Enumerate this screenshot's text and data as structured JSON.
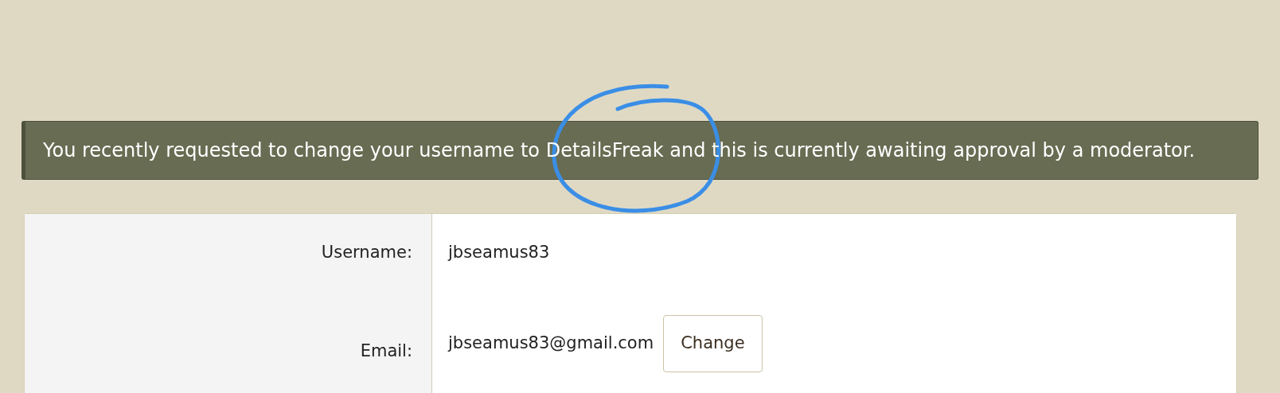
{
  "notice": {
    "text": "You recently requested to change your username to DetailsFreak and this is currently awaiting approval by a moderator."
  },
  "annotation": {
    "kind": "circle"
  },
  "fields": [
    {
      "label": "Username:",
      "value": "jbseamus83"
    },
    {
      "label": "Email:",
      "value": "jbseamus83@gmail.com",
      "button": "Change"
    }
  ]
}
